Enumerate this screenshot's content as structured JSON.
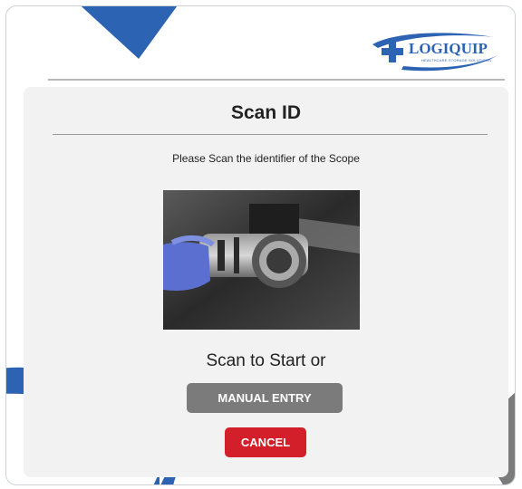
{
  "brand": {
    "name": "LOGIQUIP",
    "tagline": "HEALTHCARE STORAGE SOLUTIONS"
  },
  "dialog": {
    "title": "Scan ID",
    "instruction": "Please Scan the identifier of the Scope",
    "scan_prompt": "Scan to Start or"
  },
  "buttons": {
    "manual_entry": "MANUAL ENTRY",
    "cancel": "CANCEL"
  },
  "colors": {
    "accent_blue": "#2d63b3",
    "cancel_red": "#d31f29",
    "manual_gray": "#7b7b7b",
    "card_bg": "#f2f2f2"
  },
  "icons": [
    "medical-cross-icon",
    "down-arrow-icon",
    "curved-arrow-icon"
  ]
}
